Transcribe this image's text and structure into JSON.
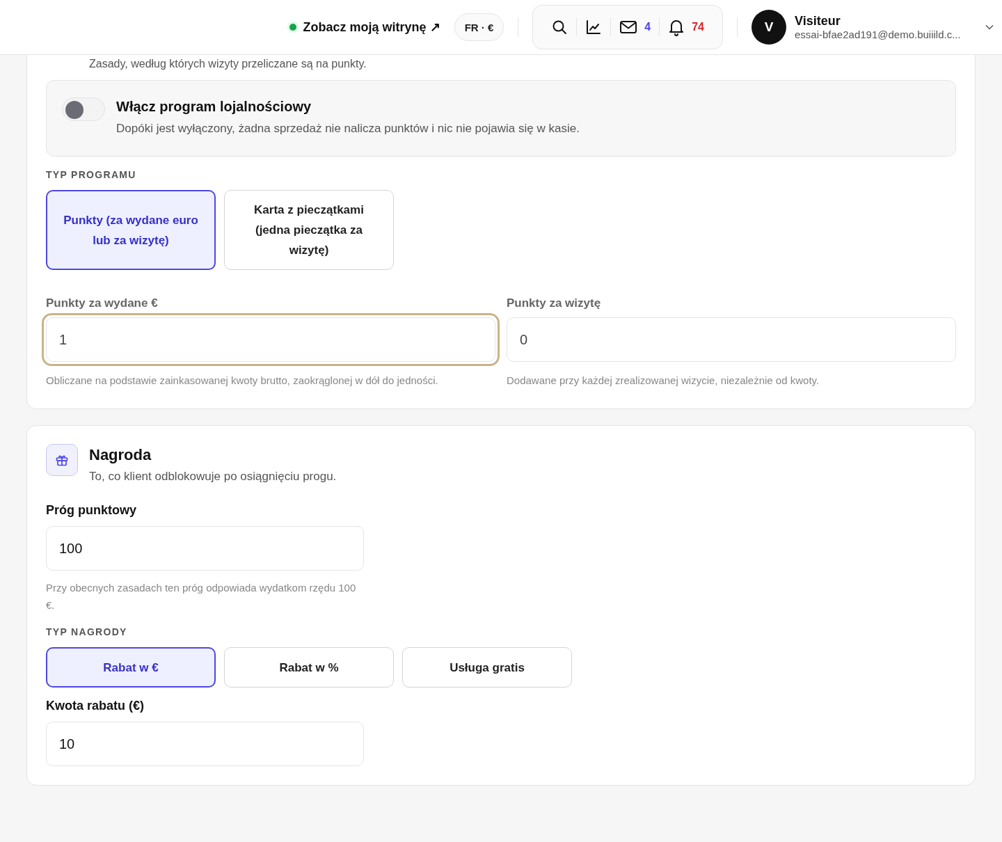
{
  "header": {
    "site_link": "Zobacz moją witrynę ↗",
    "locale": "FR · €",
    "messages_count": "4",
    "notifications_count": "74",
    "user": {
      "initial": "V",
      "name": "Visiteur",
      "email": "essai-bfae2ad191@demo.buiiild.c..."
    }
  },
  "rules": {
    "intro": "Zasady, według których wizyty przeliczane są na punkty.",
    "enable": {
      "title": "Włącz program lojalnościowy",
      "description": "Dopóki jest wyłączony, żadna sprzedaż nie nalicza punktów i nic nie pojawia się w kasie.",
      "on": false
    },
    "program_type": {
      "label": "TYP PROGRAMU",
      "options": [
        {
          "label": "Punkty (za wydane euro lub za wizytę)",
          "selected": true
        },
        {
          "label": "Karta z pieczątkami (jedna pieczątka za wizytę)",
          "selected": false
        }
      ]
    },
    "fields": [
      {
        "label": "Punkty za wydane €",
        "value": "1",
        "focused": true,
        "hint": "Obliczane na podstawie zainkasowanej kwoty brutto, zaokrąglonej w dół do jedności."
      },
      {
        "label": "Punkty za wizytę",
        "value": "0",
        "focused": false,
        "hint": "Dodawane przy każdej zrealizowanej wizycie, niezależnie od kwoty."
      }
    ]
  },
  "reward": {
    "title": "Nagroda",
    "subtitle": "To, co klient odblokowuje po osiągnięciu progu.",
    "threshold": {
      "label": "Próg punktowy",
      "value": "100",
      "hint": "Przy obecnych zasadach ten próg odpowiada wydatkom rzędu 100 €."
    },
    "reward_type": {
      "label": "TYP NAGRODY",
      "options": [
        {
          "label": "Rabat w €",
          "selected": true
        },
        {
          "label": "Rabat w %",
          "selected": false
        },
        {
          "label": "Usługa gratis",
          "selected": false
        }
      ]
    },
    "amount": {
      "label": "Kwota rabatu (€)",
      "value": "10"
    }
  }
}
